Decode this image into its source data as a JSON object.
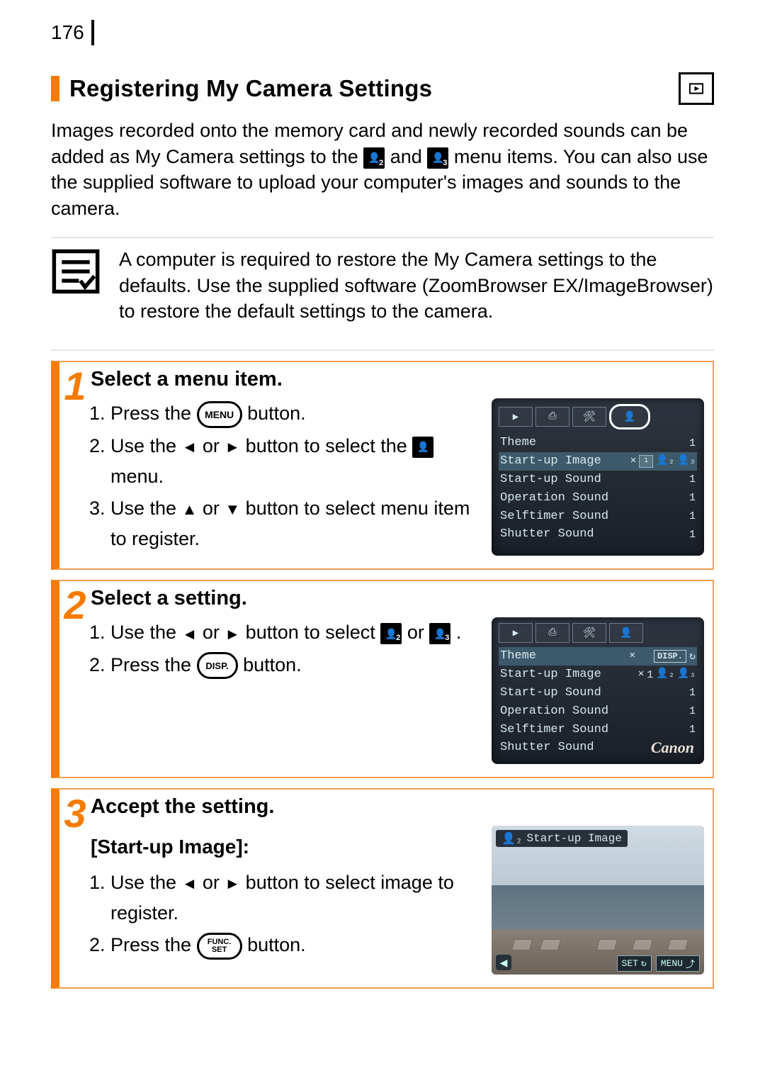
{
  "page_number": "176",
  "section_title": "Registering My Camera Settings",
  "intro": {
    "part1": "Images recorded onto the memory card and newly recorded sounds can be added as My Camera settings to the ",
    "part2": " and ",
    "part3": " menu items. You can also use the supplied software to upload your computer's images and sounds to the camera."
  },
  "icon_labels": {
    "two": "2",
    "three": "3"
  },
  "note": "A computer is required to restore the My Camera settings to the defaults. Use the supplied software (ZoomBrowser EX/ImageBrowser) to restore the default settings to the camera.",
  "steps": [
    {
      "num": "1",
      "title": "Select a menu item.",
      "items": [
        {
          "pre": "Press the ",
          "btn": "MENU",
          "post": " button."
        },
        {
          "pre": "Use the ",
          "a1": "◄",
          "mid": " or ",
          "a2": "►",
          "post": " button to select the ",
          "trail_icon": "person-menu",
          "trail_text": " menu."
        },
        {
          "pre": "Use the ",
          "a1": "▲",
          "mid": " or ",
          "a2": "▼",
          "post": " button to select menu item to register."
        }
      ],
      "lcd": {
        "highlightTab": "person",
        "rows": [
          {
            "label": "Theme",
            "val": "1"
          },
          {
            "label": "Start-up Image",
            "val": "✕ 1 ❷ ❸",
            "hl": true
          },
          {
            "label": "Start-up Sound",
            "val": "1"
          },
          {
            "label": "Operation Sound",
            "val": "1"
          },
          {
            "label": "Selftimer Sound",
            "val": "1"
          },
          {
            "label": "Shutter Sound",
            "val": "1"
          }
        ]
      }
    },
    {
      "num": "2",
      "title": "Select a setting.",
      "items": [
        {
          "pre": "Use the ",
          "a1": "◄",
          "mid": " or ",
          "a2": "►",
          "post": " button to select ",
          "trail_icon": "p2",
          "trail_text2": " or ",
          "trail_icon2": "p3",
          "trail_text3": " ."
        },
        {
          "pre": "Press the ",
          "btn": "DISP.",
          "post": " button."
        }
      ],
      "lcd": {
        "rows": [
          {
            "label": "Theme",
            "val": "✕   DISP ↻",
            "hl": true
          },
          {
            "label": "Start-up Image",
            "val": "✕ 1 ❷ ❸"
          },
          {
            "label": "Start-up Sound",
            "val": "1"
          },
          {
            "label": "Operation Sound",
            "val": "1"
          },
          {
            "label": "Selftimer Sound",
            "val": "1"
          },
          {
            "label": "Shutter Sound",
            "val": ""
          }
        ],
        "brand": "Canon"
      }
    },
    {
      "num": "3",
      "title": "Accept the setting.",
      "subheading": "[Start-up Image]:",
      "items": [
        {
          "pre": "Use the ",
          "a1": "◄",
          "mid": " or ",
          "a2": "►",
          "post": " button to select image to register."
        },
        {
          "pre": "Press the ",
          "btn_stack": [
            "FUNC.",
            "SET"
          ],
          "post": " button."
        }
      ],
      "photo": {
        "label": "Start-up Image",
        "chip_set": "SET",
        "chip_menu": "MENU"
      }
    }
  ]
}
